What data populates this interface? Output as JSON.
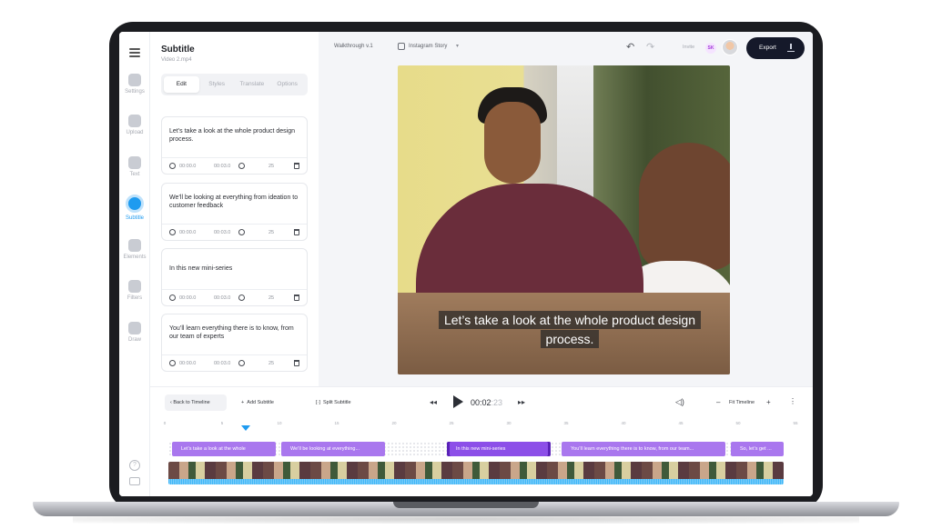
{
  "sidebar": {
    "items": [
      {
        "label": "Settings",
        "icon": "settings-icon"
      },
      {
        "label": "Upload",
        "icon": "upload-icon"
      },
      {
        "label": "Text",
        "icon": "text-icon"
      },
      {
        "label": "Subtitle",
        "icon": "subtitle-icon",
        "active": true
      },
      {
        "label": "Elements",
        "icon": "elements-icon"
      },
      {
        "label": "Filters",
        "icon": "filters-icon"
      },
      {
        "label": "Draw",
        "icon": "draw-icon"
      }
    ],
    "help_glyph": "?"
  },
  "panel": {
    "title": "Subtitle",
    "file": "Video 2.mp4",
    "tabs": [
      "Edit",
      "Styles",
      "Translate",
      "Options"
    ],
    "active_tab": "Edit",
    "cards": [
      {
        "text": "Let’s take a look at the whole product design process.",
        "start": "00:00.0",
        "end": "00:03.0",
        "count": "25"
      },
      {
        "text": "We’ll be looking at everything from ideation to customer feedback",
        "start": "00:00.0",
        "end": "00:03.0",
        "count": "25"
      },
      {
        "text": "In this new mini-series",
        "start": "00:00.0",
        "end": "00:03.0",
        "count": "25"
      },
      {
        "text": "You’ll learn everything there is to know, from our team of experts",
        "start": "00:00.0",
        "end": "00:03.0",
        "count": "25"
      }
    ]
  },
  "topbar": {
    "project": "Walkthrough v.1",
    "format": "Instagram Story",
    "format_chevron": "▾",
    "undo_glyph": "↶",
    "redo_glyph": "↷",
    "invite": "Invite",
    "user_initials": "SK",
    "export_label": "Export"
  },
  "video": {
    "caption": "Let’s take a look at the whole product design process."
  },
  "timeline": {
    "back_label": "Back to Timeline",
    "add_label": "Add Subtitle",
    "split_label": "Split Subtitle",
    "prev_glyph": "◂◂",
    "next_glyph": "▸▸",
    "time_current": "00:02",
    "time_frac": ":23",
    "volume_glyph": "◁)",
    "zoom_minus": "–",
    "zoom_label": "Fit Timeline",
    "zoom_plus": "+",
    "more_glyph": "⋮",
    "ruler": [
      "0",
      "5",
      "10",
      "15",
      "20",
      "25",
      "30",
      "35",
      "40",
      "45",
      "50",
      "55",
      "60"
    ],
    "clips": [
      {
        "text": "Let’s take a look at the whole"
      },
      {
        "text": "We’ll be looking at everything..."
      },
      {
        "text": "In this new mini-series",
        "selected": true
      },
      {
        "text": "You’ll learn everything there is to know, from our team..."
      },
      {
        "text": "So, let’s get ..."
      }
    ]
  },
  "colors": {
    "accent": "#1e9bf0",
    "clip": "#a977ee",
    "export_bg": "#15192a"
  }
}
